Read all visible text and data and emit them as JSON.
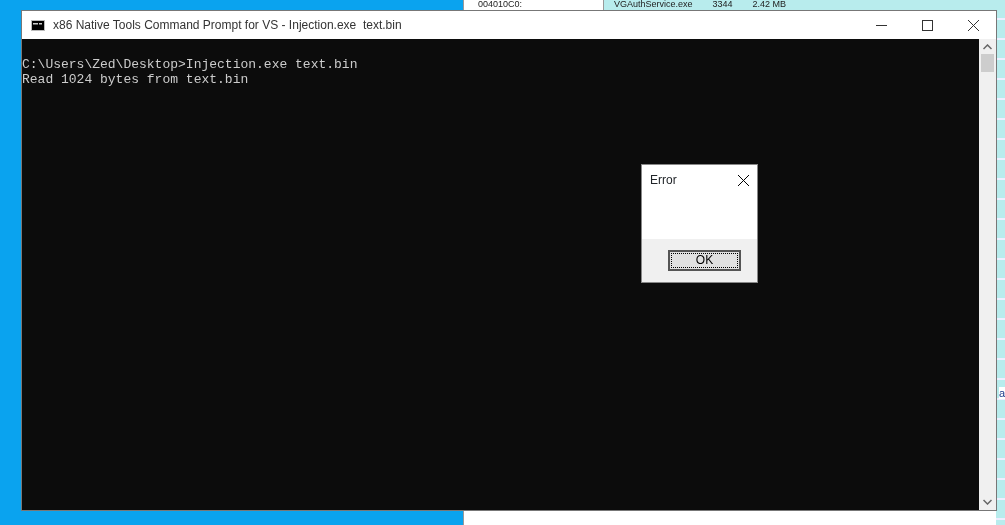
{
  "background_window": {
    "cells": [
      "004010C0:",
      "VGAuthService.exe",
      "3344",
      "2.42 MB"
    ],
    "fragment": "a"
  },
  "console_window": {
    "title": "x86 Native Tools Command Prompt for VS - Injection.exe  text.bin",
    "lines": [
      "C:\\Users\\Zed\\Desktop>Injection.exe text.bin",
      "Read 1024 bytes from text.bin"
    ]
  },
  "dialog": {
    "title": "Error",
    "buttons": [
      {
        "label": "OK",
        "selected": true
      }
    ]
  }
}
